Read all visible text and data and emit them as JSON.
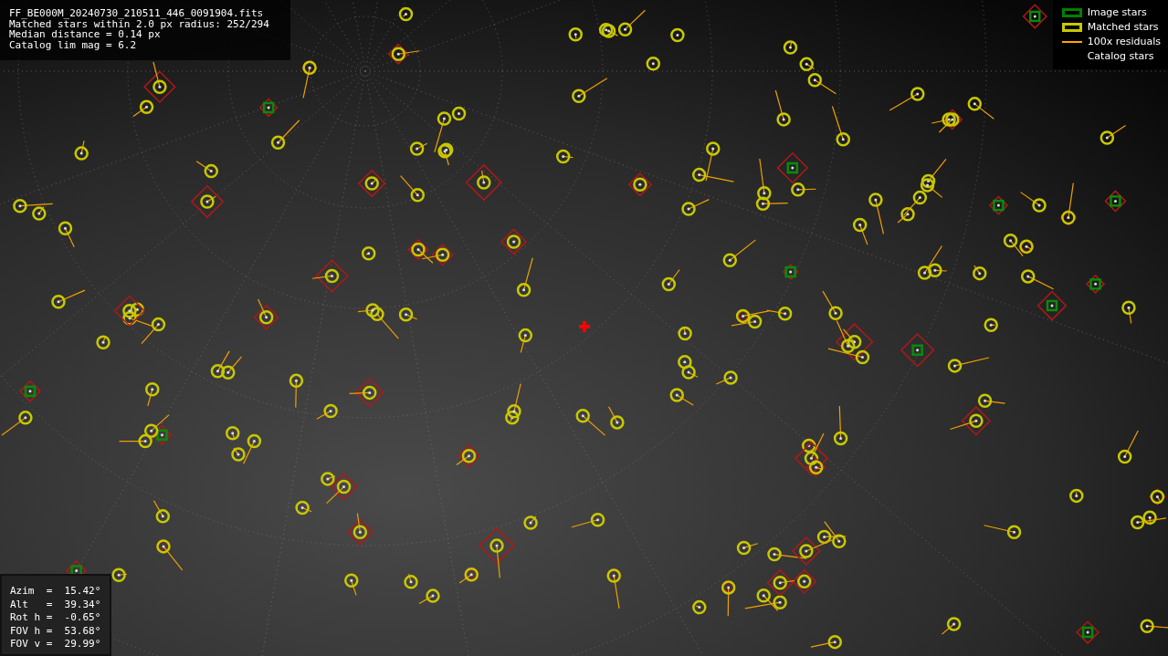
{
  "info": [
    "FF_BE000M_20240730_210511_446_0091904.fits",
    "Matched stars within 2.0 px radius: 252/294",
    "Median distance = 0.14 px",
    "Catalog lim mag = 6.2"
  ],
  "legend": [
    {
      "label": "Image stars",
      "kind": "box",
      "color": "#008000"
    },
    {
      "label": "Matched stars",
      "kind": "box",
      "color": "#c8c800"
    },
    {
      "label": "100x residuals",
      "kind": "line",
      "color": "#ffa500"
    },
    {
      "label": "Catalog stars",
      "kind": "none"
    }
  ],
  "pointing": [
    "Azim  =  15.42°",
    "Alt   =  39.34°",
    "Rot h =  -0.65°",
    "FOV h =  53.68°",
    "FOV v =  29.99°"
  ]
}
